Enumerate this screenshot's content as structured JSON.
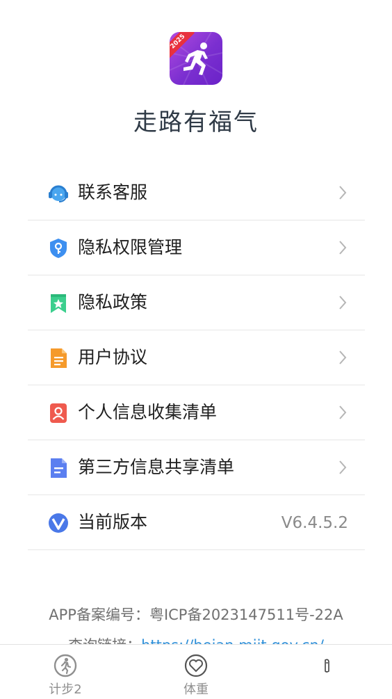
{
  "app": {
    "name": "走路有福气",
    "icon_badge": "2025",
    "icon_colors": [
      "#b04be0",
      "#6a22c8"
    ]
  },
  "menu": {
    "items": [
      {
        "label": "联系客服",
        "icon": "customer-service-icon"
      },
      {
        "label": "隐私权限管理",
        "icon": "privacy-shield-icon"
      },
      {
        "label": "隐私政策",
        "icon": "bookmark-star-icon"
      },
      {
        "label": "用户协议",
        "icon": "document-icon"
      },
      {
        "label": "个人信息收集清单",
        "icon": "person-card-icon"
      },
      {
        "label": "第三方信息共享清单",
        "icon": "share-doc-icon"
      },
      {
        "label": "当前版本",
        "icon": "version-v-icon",
        "value": "V6.4.5.2"
      }
    ]
  },
  "footer": {
    "icp": "APP备案编号：粤ICP备2023147511号-22A",
    "query_prefix": "查询链接：",
    "query_link": "https://beian.miit.gov.cn/"
  },
  "tabbar": {
    "tabs": [
      {
        "label": "计步2",
        "icon": "walker-icon"
      },
      {
        "label": "体重",
        "icon": "heart-icon"
      },
      {
        "label": "",
        "icon": "profile-icon"
      }
    ]
  },
  "colors": {
    "accent": "#2e8fd8",
    "text": "#1f1f1f",
    "muted": "#8a8a8a"
  }
}
